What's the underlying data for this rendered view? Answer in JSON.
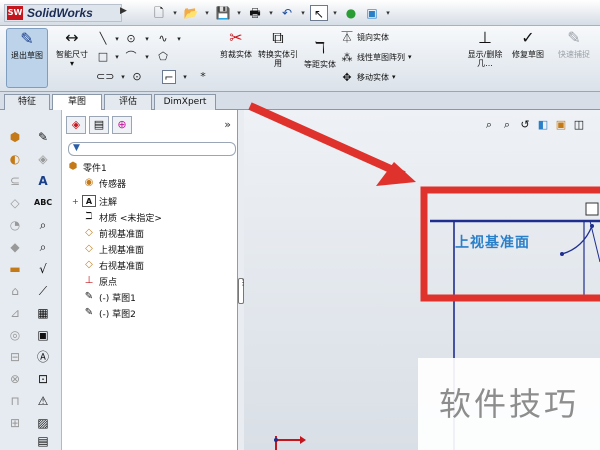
{
  "app": {
    "logo_badge": "SW",
    "name": "SolidWorks"
  },
  "quick_access": [
    "new",
    "open",
    "save",
    "print",
    "undo",
    "select",
    "rebuild",
    "options"
  ],
  "command_manager": {
    "exit_sketch": "退出草图",
    "smart_dimension": "智能尺寸",
    "trim_entities": "剪裁实体",
    "convert_entities": "转换实体引用",
    "offset_entities": "等距实体",
    "mirror_entities": "镜向实体",
    "linear_pattern": "线性草图阵列",
    "move_entities": "移动实体",
    "display_relations": "显示/删除几...",
    "repair_sketch": "修复草图",
    "quick_snaps": "快速捕捉"
  },
  "tabs": [
    {
      "label": "特征",
      "active": false
    },
    {
      "label": "草图",
      "active": true
    },
    {
      "label": "评估",
      "active": false
    },
    {
      "label": "DimXpert",
      "active": false
    }
  ],
  "feature_tree": {
    "root": "零件1",
    "items": [
      "传感器",
      "注解",
      "材质 <未指定>",
      "前视基准面",
      "上视基准面",
      "右视基准面",
      "原点",
      "(-) 草图1",
      "(-) 草图2"
    ]
  },
  "graphics": {
    "plane_label": "上视基准面",
    "watermark": "软件技巧",
    "colors": {
      "annotation_red": "#e0322c",
      "sketch_blue": "#1f2e8f",
      "plane_label_blue": "#2a7fc9"
    }
  }
}
